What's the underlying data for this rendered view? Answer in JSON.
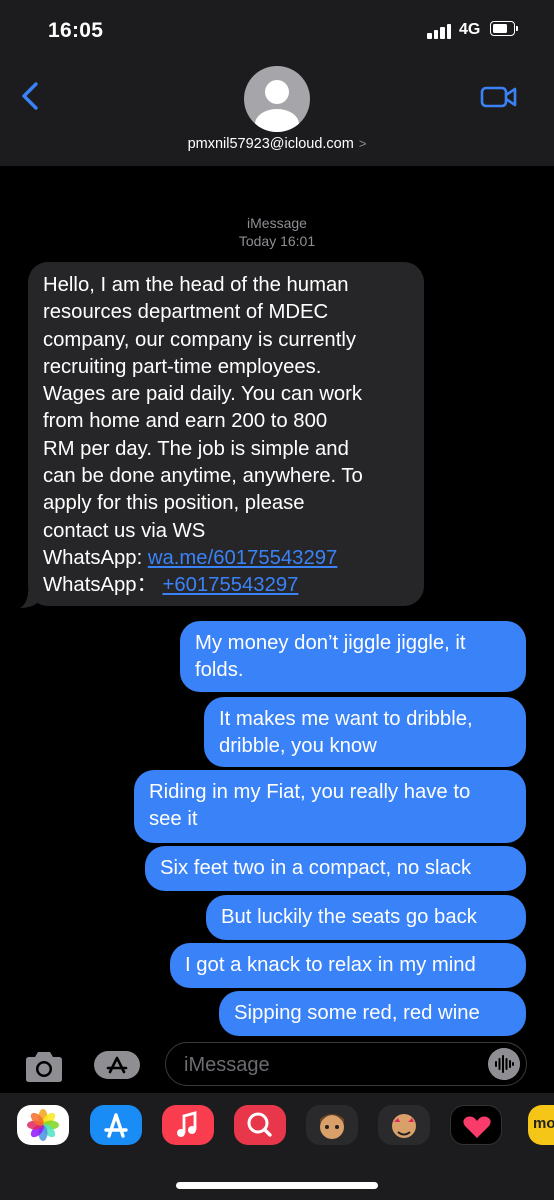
{
  "status_bar": {
    "time": "16:05",
    "network": "4G"
  },
  "header": {
    "contact": "pmxnil57923@icloud.com",
    "contact_chevron": ">"
  },
  "thread": {
    "service": "iMessage",
    "timestamp": "Today 16:01"
  },
  "incoming": {
    "lines": [
      "Hello, I am the head of the human",
      "resources department of MDEC",
      "company, our company is currently",
      "recruiting part-time employees.",
      "Wages are paid daily. You can work",
      "from home and earn 200 to 800",
      "RM per day. The job is simple and",
      "can be done anytime, anywhere. To",
      "apply for this position, please",
      "contact us via WS"
    ],
    "wa1_label": "WhatsApp: ",
    "wa1_link": "wa.me/60175543297",
    "wa2_label": "WhatsApp： ",
    "wa2_link": "+60175543297"
  },
  "outgoing": [
    {
      "lines": [
        "My money don’t jiggle jiggle, it",
        "folds."
      ]
    },
    {
      "lines": [
        "It makes me want to dribble,",
        "dribble, you know"
      ]
    },
    {
      "lines": [
        "Riding in my Fiat, you really have to",
        "see it"
      ]
    },
    {
      "lines": [
        "Six feet two in a compact, no slack"
      ]
    },
    {
      "lines": [
        "But luckily the seats go back"
      ]
    },
    {
      "lines": [
        "I got a knack to relax in my mind"
      ]
    },
    {
      "lines": [
        "Sipping some red, red wine"
      ]
    }
  ],
  "compose": {
    "placeholder": "iMessage"
  },
  "drawer": {
    "apps": [
      "photos-icon",
      "app-store-icon",
      "music-icon",
      "web-search-icon",
      "memoji-icon",
      "memoji-stickers-icon",
      "digital-touch-icon",
      "partial-app-icon"
    ],
    "partial_app_text": "mo"
  },
  "colors": {
    "outgoing_bubble": "#3a82f7",
    "incoming_bubble": "#262628",
    "accent": "#3a82f7",
    "header_bg": "#1c1c1e"
  }
}
